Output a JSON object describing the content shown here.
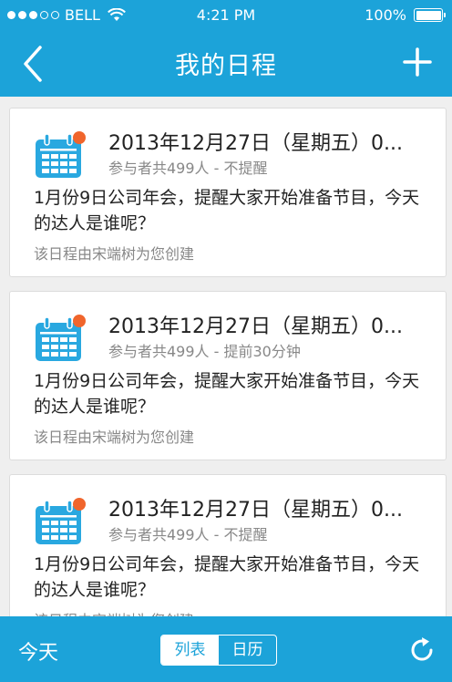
{
  "status_bar": {
    "carrier": "BELL",
    "time": "4:21 PM",
    "battery": "100%"
  },
  "nav": {
    "title": "我的日程"
  },
  "schedules": [
    {
      "date": "2013年12月27日（星期五）0...",
      "meta": "参与者共499人 - 不提醒",
      "description": "1月份9日公司年会，提醒大家开始准备节目，今天的达人是谁呢？",
      "creator": "该日程由宋端树为您创建"
    },
    {
      "date": "2013年12月27日（星期五）0...",
      "meta": "参与者共499人 - 提前30分钟",
      "description": "1月份9日公司年会，提醒大家开始准备节目，今天的达人是谁呢？",
      "creator": "该日程由宋端树为您创建"
    },
    {
      "date": "2013年12月27日（星期五）0...",
      "meta": "参与者共499人 - 不提醒",
      "description": "1月份9日公司年会，提醒大家开始准备节目，今天的达人是谁呢？",
      "creator": "该日程由宋端树为您创建"
    }
  ],
  "bottom_bar": {
    "today_label": "今天",
    "view_list_label": "列表",
    "view_calendar_label": "日历",
    "active_view": "list"
  },
  "colors": {
    "primary": "#1ca3d9",
    "calendar_icon": "#29a8e0",
    "notification_dot": "#f0652c"
  },
  "icons": {
    "back": "chevron-left-icon",
    "add": "plus-icon",
    "calendar": "calendar-icon",
    "refresh": "refresh-icon",
    "wifi": "wifi-icon",
    "battery": "battery-icon"
  }
}
